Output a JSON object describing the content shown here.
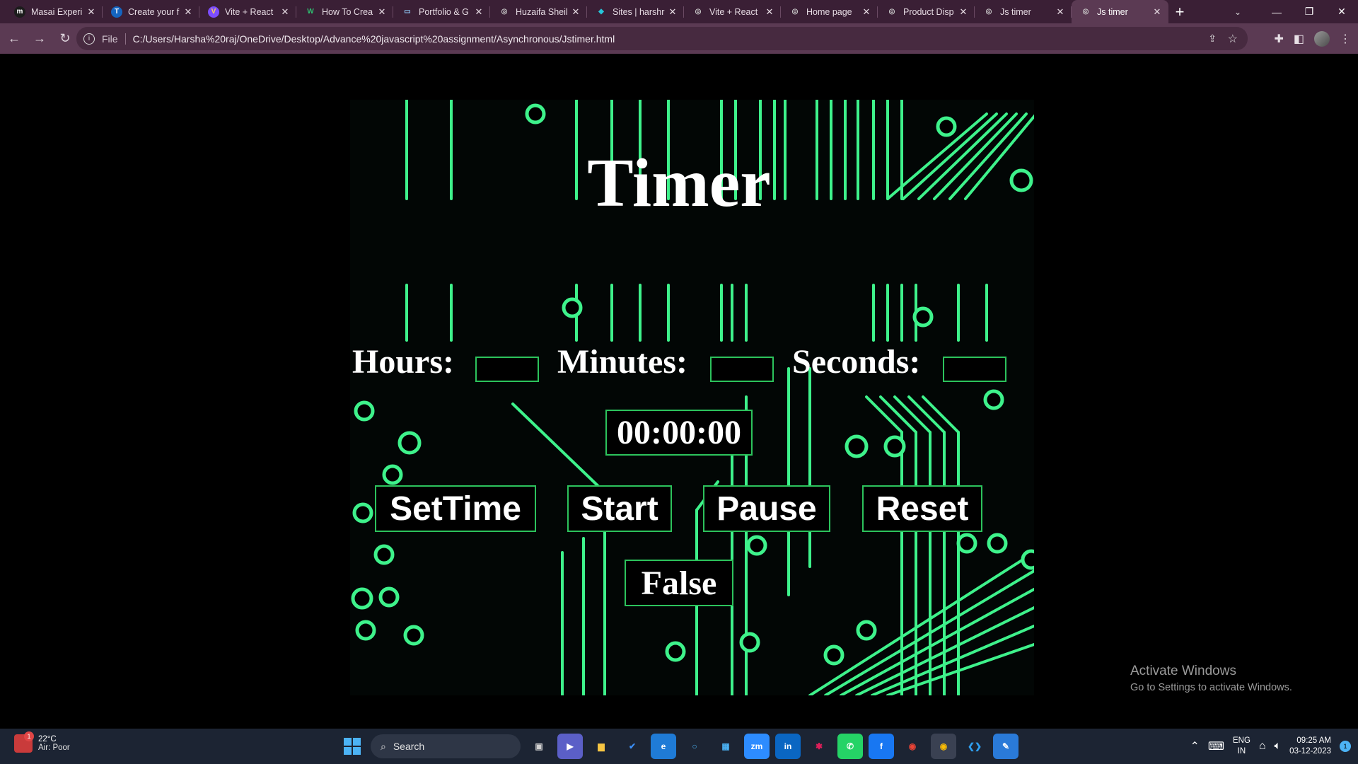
{
  "browser": {
    "tabs": [
      {
        "title": "Masai Experi",
        "favicon": "m",
        "favicon_color": "#ffffff",
        "favicon_bg": "#1c1c1c"
      },
      {
        "title": "Create your f",
        "favicon": "T",
        "favicon_color": "#ffffff",
        "favicon_bg": "#1565c0"
      },
      {
        "title": "Vite + React",
        "favicon": "V",
        "favicon_color": "#ffd54f",
        "favicon_bg": "#7c4dff"
      },
      {
        "title": "How To Crea",
        "favicon": "W",
        "favicon_color": "#2fbf71",
        "favicon_bg": "transparent"
      },
      {
        "title": "Portfolio & G",
        "favicon": "▭",
        "favicon_color": "#90caf9",
        "favicon_bg": "transparent"
      },
      {
        "title": "Huzaifa Sheil",
        "favicon": "◎",
        "favicon_color": "#cccccc",
        "favicon_bg": "transparent"
      },
      {
        "title": "Sites | harshr",
        "favicon": "◆",
        "favicon_color": "#26c6da",
        "favicon_bg": "transparent"
      },
      {
        "title": "Vite + React",
        "favicon": "◎",
        "favicon_color": "#cccccc",
        "favicon_bg": "transparent"
      },
      {
        "title": "Home page",
        "favicon": "◎",
        "favicon_color": "#cccccc",
        "favicon_bg": "transparent"
      },
      {
        "title": "Product Disp",
        "favicon": "◎",
        "favicon_color": "#cccccc",
        "favicon_bg": "transparent"
      },
      {
        "title": "Js timer",
        "favicon": "◎",
        "favicon_color": "#cccccc",
        "favicon_bg": "transparent"
      },
      {
        "title": "Js timer",
        "favicon": "◎",
        "favicon_color": "#cccccc",
        "favicon_bg": "transparent",
        "active": true
      }
    ],
    "new_tab": "+",
    "window_controls": {
      "minimize": "—",
      "restore": "❐",
      "close": "✕"
    },
    "address": {
      "scheme": "File",
      "url": "C:/Users/Harsha%20raj/OneDrive/Desktop/Advance%20javascript%20assignment/Asynchronous/Jstimer.html"
    }
  },
  "page": {
    "title": "Timer",
    "labels": {
      "hours": "Hours:",
      "minutes": "Minutes:",
      "seconds": "Seconds:"
    },
    "fields": {
      "hours": "",
      "minutes": "",
      "seconds": ""
    },
    "display": "00:00:00",
    "buttons": {
      "set_time": "SetTime",
      "start": "Start",
      "pause": "Pause",
      "reset": "Reset"
    },
    "status": "False",
    "accent_color": "#2cc25c",
    "circuit_color": "#3ef28b"
  },
  "overlay": {
    "activate_title": "Activate Windows",
    "activate_sub": "Go to Settings to activate Windows."
  },
  "taskbar": {
    "weather": {
      "temp": "22°C",
      "condition": "Air: Poor",
      "badge": "1"
    },
    "search_placeholder": "Search",
    "apps": [
      {
        "name": "task-view-icon",
        "glyph": "▣",
        "bg": "transparent",
        "color": "#d0d0d0"
      },
      {
        "name": "meet-icon",
        "glyph": "▶",
        "bg": "#5b5fc7",
        "color": "#ffffff"
      },
      {
        "name": "file-explorer-icon",
        "glyph": "▆",
        "bg": "transparent",
        "color": "#f6c543"
      },
      {
        "name": "todo-icon",
        "glyph": "✔",
        "bg": "transparent",
        "color": "#3b8ef5"
      },
      {
        "name": "edge-icon",
        "glyph": "e",
        "bg": "#1f7bd6",
        "color": "#ffffff"
      },
      {
        "name": "cortana-icon",
        "glyph": "○",
        "bg": "transparent",
        "color": "#4cb3f5"
      },
      {
        "name": "store-icon",
        "glyph": "▦",
        "bg": "transparent",
        "color": "#4cb3f5"
      },
      {
        "name": "zoom-icon",
        "glyph": "zm",
        "bg": "#2d8cff",
        "color": "#ffffff"
      },
      {
        "name": "linkedin-icon",
        "glyph": "in",
        "bg": "#0a66c2",
        "color": "#ffffff"
      },
      {
        "name": "slack-icon",
        "glyph": "✱",
        "bg": "transparent",
        "color": "#e01e5a"
      },
      {
        "name": "whatsapp-icon",
        "glyph": "✆",
        "bg": "#25d366",
        "color": "#ffffff"
      },
      {
        "name": "facebook-icon",
        "glyph": "f",
        "bg": "#1877f2",
        "color": "#ffffff"
      },
      {
        "name": "chrome-icon",
        "glyph": "◉",
        "bg": "transparent",
        "color": "#ea4335"
      },
      {
        "name": "chrome-profile-icon",
        "glyph": "◉",
        "bg": "#3a4152",
        "color": "#fbbc04"
      },
      {
        "name": "vscode-icon",
        "glyph": "❮❯",
        "bg": "transparent",
        "color": "#2f9ff0"
      },
      {
        "name": "paint-icon",
        "glyph": "✎",
        "bg": "#2a7ad8",
        "color": "#ffffff"
      }
    ],
    "tray": {
      "lang": "ENG",
      "region": "IN",
      "time": "09:25 AM",
      "date": "03-12-2023",
      "notifications": "1"
    }
  }
}
